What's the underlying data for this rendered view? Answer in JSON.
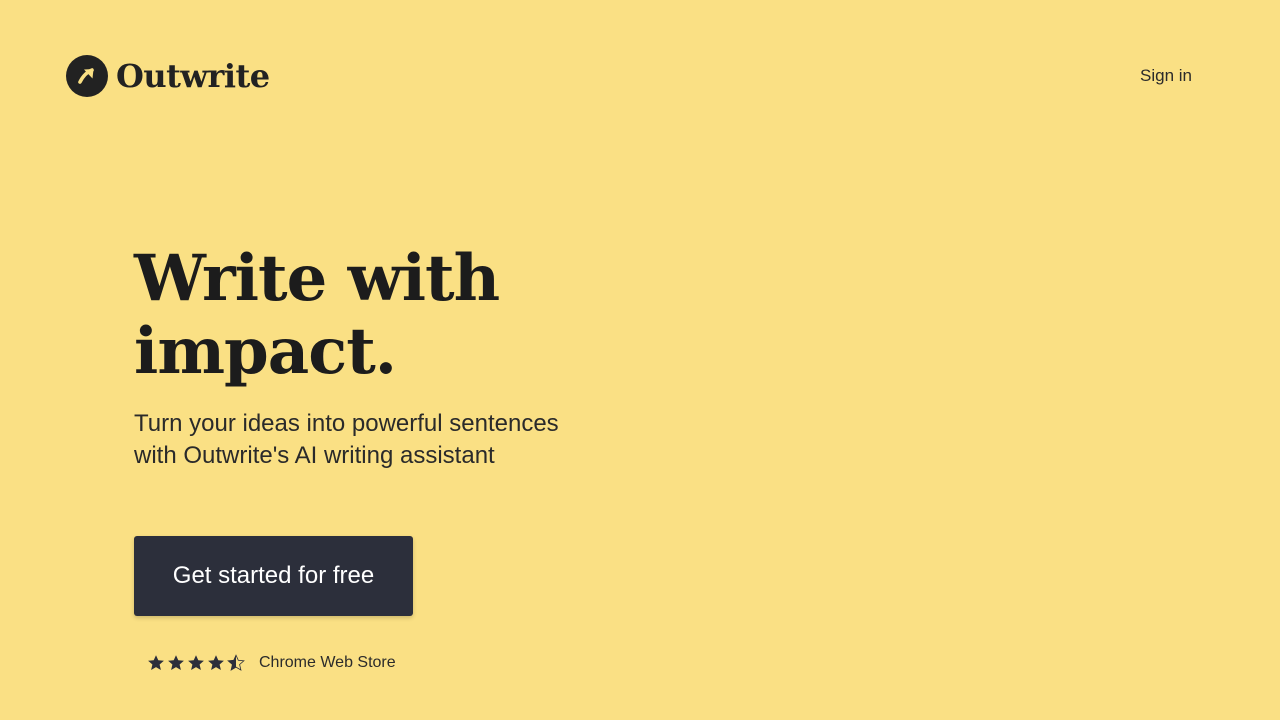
{
  "header": {
    "brand_name": "Outwrite",
    "logo_icon": "arrow-up-right-circle-icon",
    "sign_in_label": "Sign in"
  },
  "hero": {
    "headline_line1": "Write with",
    "headline_line2": "impact.",
    "subheadline_line1": "Turn your ideas into powerful sentences",
    "subheadline_line2": "with Outwrite's AI writing assistant",
    "cta_label": "Get started for free"
  },
  "rating": {
    "stars": 4.5,
    "max_stars": 5,
    "star_icon": "star-icon",
    "source_label": "Chrome Web Store"
  },
  "colors": {
    "background": "#fae084",
    "text_dark": "#1c1c1c",
    "button_bg": "#2c2f3b",
    "button_text": "#ffffff",
    "star_color": "#2c2f3b"
  }
}
